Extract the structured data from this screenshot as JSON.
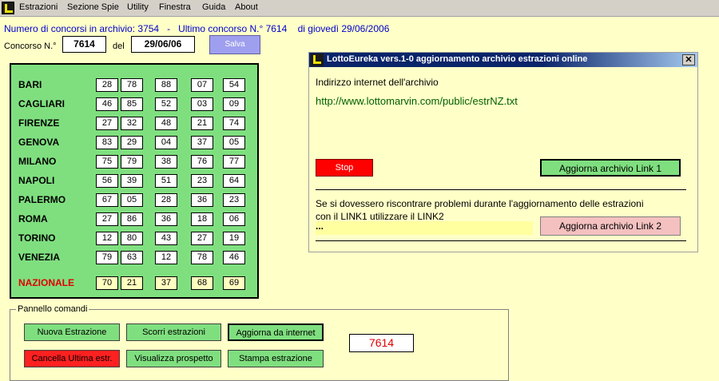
{
  "menu": [
    "Estrazioni",
    "Sezione Spie",
    "Utility",
    "Finestra",
    "Guida",
    "About"
  ],
  "info": "Numero di concorsi in archivio: 3754   -   Ultimo concorso N.° 7614    di giovedì 29/06/2006",
  "concorso": {
    "label": "Concorso N.°",
    "value": "7614",
    "del_label": "del",
    "date": "29/06/06",
    "save": "Salva"
  },
  "ruote": [
    {
      "name": "BARI",
      "nums": [
        "28",
        "78",
        "88",
        "07",
        "54"
      ]
    },
    {
      "name": "CAGLIARI",
      "nums": [
        "46",
        "85",
        "52",
        "03",
        "09"
      ]
    },
    {
      "name": "FIRENZE",
      "nums": [
        "27",
        "32",
        "48",
        "21",
        "74"
      ]
    },
    {
      "name": "GENOVA",
      "nums": [
        "83",
        "29",
        "04",
        "37",
        "05"
      ]
    },
    {
      "name": "MILANO",
      "nums": [
        "75",
        "79",
        "38",
        "76",
        "77"
      ]
    },
    {
      "name": "NAPOLI",
      "nums": [
        "56",
        "39",
        "51",
        "23",
        "64"
      ]
    },
    {
      "name": "PALERMO",
      "nums": [
        "67",
        "05",
        "28",
        "36",
        "23"
      ]
    },
    {
      "name": "ROMA",
      "nums": [
        "27",
        "86",
        "36",
        "18",
        "06"
      ]
    },
    {
      "name": "TORINO",
      "nums": [
        "12",
        "80",
        "43",
        "27",
        "19"
      ]
    },
    {
      "name": "VENEZIA",
      "nums": [
        "79",
        "63",
        "12",
        "78",
        "46"
      ]
    },
    {
      "name": "NAZIONALE",
      "nums": [
        "70",
        "21",
        "37",
        "68",
        "69"
      ]
    }
  ],
  "comandi": {
    "legend": "Pannello comandi",
    "buttons": [
      "Nuova Estrazione",
      "Scorri estrazioni",
      "Aggiorna da internet",
      "Cancella Ultima estr.",
      "Visualizza prospetto",
      "Stampa estrazione"
    ],
    "counter": "7614"
  },
  "dialog": {
    "title": "LottoEureka vers.1-0 aggiornamento archivio estrazioni online",
    "addr_label": "Indirizzo internet dell'archivio",
    "url": "http://www.lottomarvin.com/public/estrNZ.txt",
    "stop": "Stop",
    "link1": "Aggiorna archivio Link 1",
    "note1": "Se si dovessero riscontrare problemi durante l'aggiornamento delle estrazioni",
    "note2": "con il LINK1 utilizzare il LINK2",
    "status": "...",
    "link2": "Aggiorna archivio Link 2",
    "close": "✕"
  }
}
